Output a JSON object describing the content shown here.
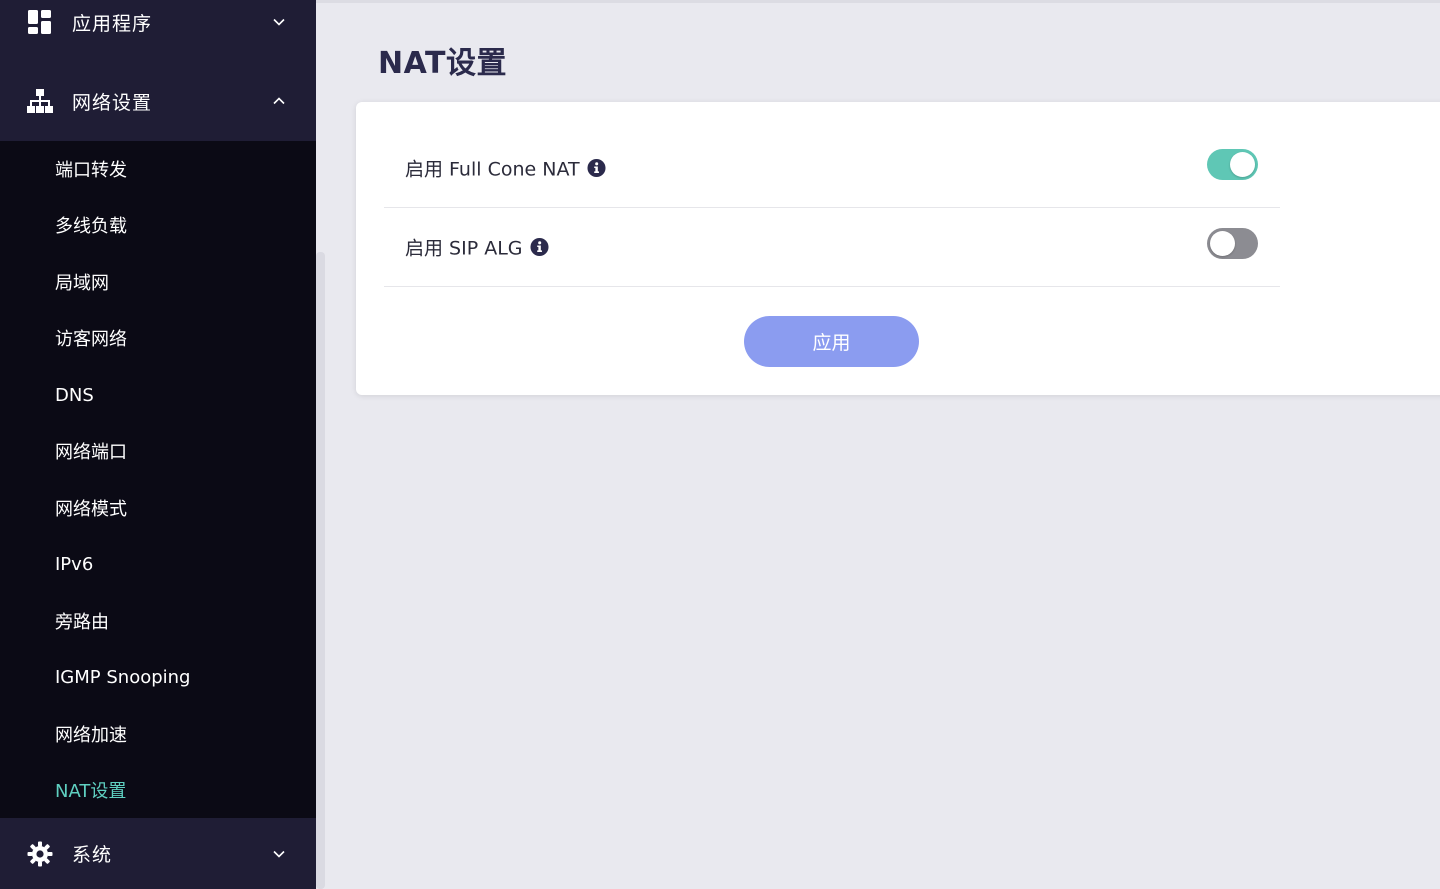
{
  "sidebar": {
    "groups": [
      {
        "label": "应用程序",
        "icon": "grid-icon",
        "expanded": false
      },
      {
        "label": "网络设置",
        "icon": "network-icon",
        "expanded": true
      },
      {
        "label": "系统",
        "icon": "gear-icon",
        "expanded": false
      }
    ],
    "network_items": [
      {
        "label": "端口转发"
      },
      {
        "label": "多线负载"
      },
      {
        "label": "局域网"
      },
      {
        "label": "访客网络"
      },
      {
        "label": "DNS"
      },
      {
        "label": "网络端口"
      },
      {
        "label": "网络模式"
      },
      {
        "label": "IPv6"
      },
      {
        "label": "旁路由"
      },
      {
        "label": "IGMP Snooping"
      },
      {
        "label": "网络加速"
      },
      {
        "label": "NAT设置",
        "active": true
      }
    ]
  },
  "main": {
    "title": "NAT设置",
    "settings": [
      {
        "label": "启用 Full Cone NAT",
        "enabled": true,
        "info_icon": "info-icon"
      },
      {
        "label": "启用 SIP ALG",
        "enabled": false,
        "info_icon": "info-icon"
      }
    ],
    "apply_label": "应用"
  },
  "colors": {
    "sidebar_bg": "#1f1d35",
    "submenu_bg": "#0b0a15",
    "active_item": "#5fd0c1",
    "toggle_on": "#5fc7b5",
    "toggle_off": "#8c8c92",
    "apply_button": "#8b9cf0",
    "title": "#2b2a4c"
  }
}
